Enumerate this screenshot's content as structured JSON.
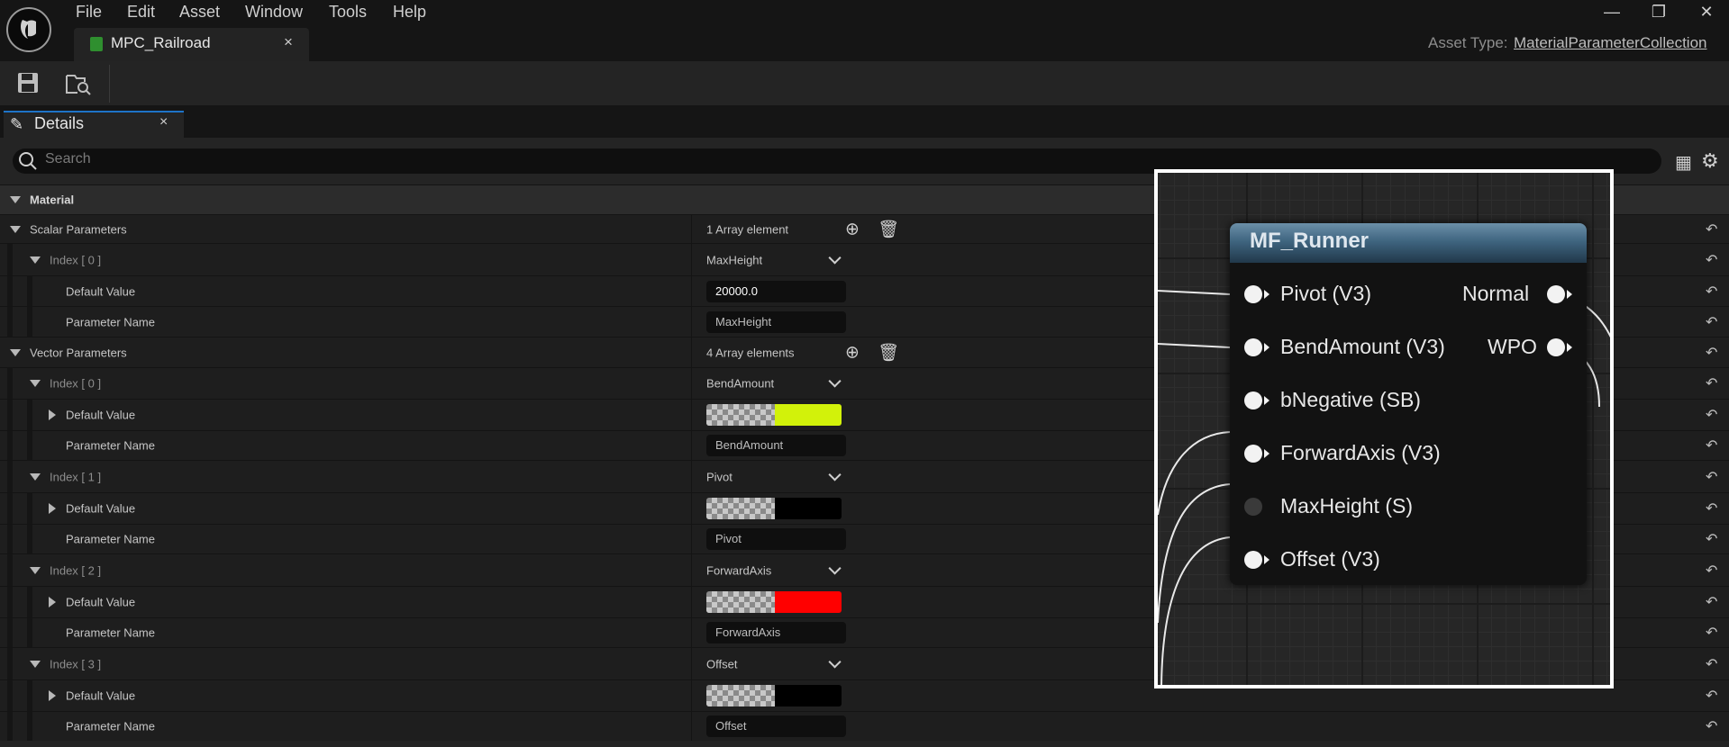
{
  "app": {
    "menu": [
      "File",
      "Edit",
      "Asset",
      "Window",
      "Tools",
      "Help"
    ],
    "tab_title": "MPC_Railroad",
    "tab_close": "×",
    "asset_type_label": "Asset Type:",
    "asset_type_value": "MaterialParameterCollection",
    "window_controls": {
      "minimize": "—",
      "restore": "❐",
      "close": "✕"
    }
  },
  "details": {
    "tab_label": "Details",
    "tab_close": "×",
    "search_placeholder": "Search"
  },
  "properties": {
    "material_category": "Material",
    "scalar": {
      "label": "Scalar Parameters",
      "count": "1 Array element",
      "items": [
        {
          "index": "Index [ 0 ]",
          "combo": "MaxHeight",
          "default_label": "Default Value",
          "default_value": "20000.0",
          "param_label": "Parameter Name",
          "param_value": "MaxHeight"
        }
      ]
    },
    "vector": {
      "label": "Vector Parameters",
      "count": "4 Array elements",
      "items": [
        {
          "index": "Index [ 0 ]",
          "combo": "BendAmount",
          "default_label": "Default Value",
          "color": "#d2f20a",
          "param_label": "Parameter Name",
          "param_value": "BendAmount"
        },
        {
          "index": "Index [ 1 ]",
          "combo": "Pivot",
          "default_label": "Default Value",
          "color": "#000000",
          "param_label": "Parameter Name",
          "param_value": "Pivot"
        },
        {
          "index": "Index [ 2 ]",
          "combo": "ForwardAxis",
          "default_label": "Default Value",
          "color": "#ff0000",
          "param_label": "Parameter Name",
          "param_value": "ForwardAxis"
        },
        {
          "index": "Index [ 3 ]",
          "combo": "Offset",
          "default_label": "Default Value",
          "color": "#000000",
          "param_label": "Parameter Name",
          "param_value": "Offset"
        }
      ]
    }
  },
  "node": {
    "title": "MF_Runner",
    "inputs": [
      "Pivot (V3)",
      "BendAmount (V3)",
      "bNegative (SB)",
      "ForwardAxis (V3)",
      "MaxHeight (S)",
      "Offset (V3)"
    ],
    "outputs": [
      "Normal",
      "WPO"
    ]
  }
}
